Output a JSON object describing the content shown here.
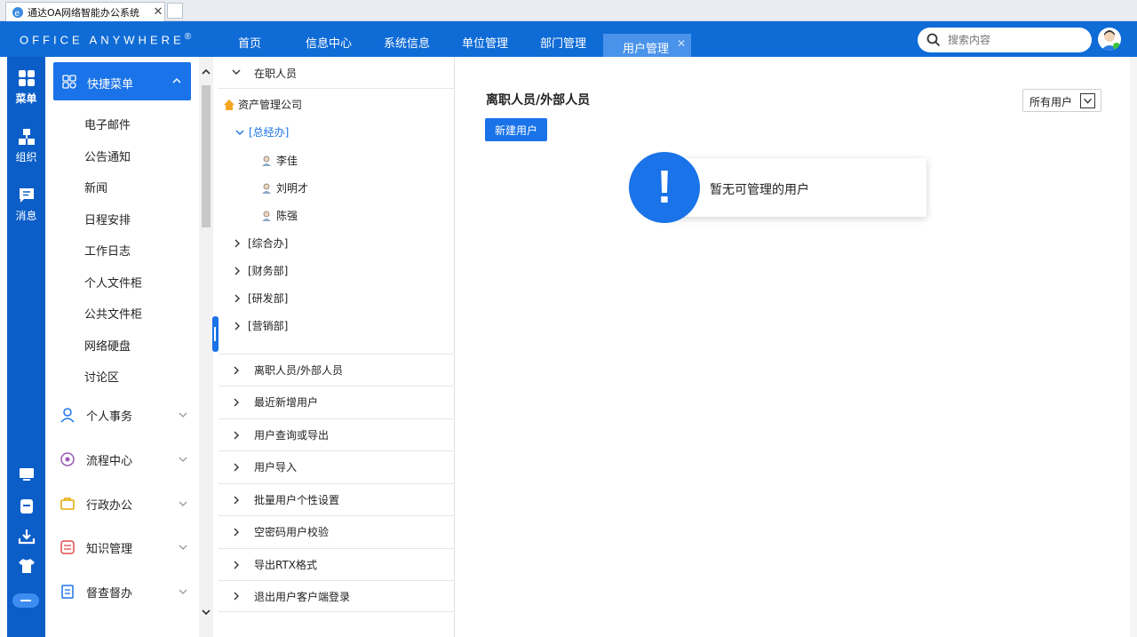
{
  "browser": {
    "tab_title": "通达OA网络智能办公系统",
    "close": "✕"
  },
  "header": {
    "logo": "OFFICE ANYWHERE",
    "logo_mark": "®",
    "nav": [
      "首页",
      "信息中心",
      "系统信息",
      "单位管理",
      "部门管理"
    ],
    "active_tab": "用户管理",
    "active_close": "✕",
    "search_placeholder": "搜索内容"
  },
  "rail": {
    "items": [
      "菜单",
      "组织",
      "消息"
    ]
  },
  "menu": {
    "quick_label": "快捷菜单",
    "sub_items": [
      "电子邮件",
      "公告通知",
      "新闻",
      "日程安排",
      "工作日志",
      "个人文件柜",
      "公共文件柜",
      "网络硬盘",
      "讨论区"
    ],
    "groups": [
      "个人事务",
      "流程中心",
      "行政办公",
      "知识管理",
      "督查督办"
    ]
  },
  "tree": {
    "header": "在职人员",
    "company": "资产管理公司",
    "expanded_dept": "[总经办]",
    "members": [
      "李佳",
      "刘明才",
      "陈强"
    ],
    "depts": [
      "[综合办]",
      "[财务部]",
      "[研发部]",
      "[营销部]"
    ],
    "sections": [
      "离职人员/外部人员",
      "最近新增用户",
      "用户查询或导出",
      "用户导入",
      "批量用户个性设置",
      "空密码用户校验",
      "导出RTX格式",
      "退出用户客户端登录"
    ]
  },
  "content": {
    "title": "离职人员/外部人员",
    "filter_value": "所有用户",
    "new_button": "新建用户",
    "notice_icon": "!",
    "notice_text": "暂无可管理的用户"
  },
  "colors": {
    "primary": "#1a73e8",
    "topbar": "#0f6bd6",
    "rail": "#0b5ec8"
  }
}
